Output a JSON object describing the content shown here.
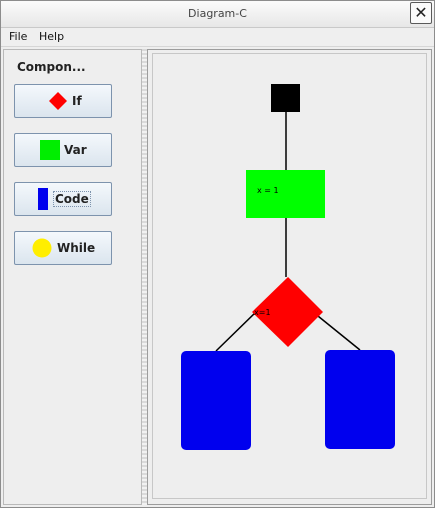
{
  "window": {
    "title": "Diagram-C",
    "close_glyph": "✕"
  },
  "menu": {
    "items": [
      "File",
      "Help"
    ]
  },
  "components": {
    "heading": "Compon...",
    "buttons": [
      {
        "label": "If",
        "icon": "red-diamond-icon",
        "color": "#ff0000"
      },
      {
        "label": "Var",
        "icon": "green-square-icon",
        "color": "#00ee00"
      },
      {
        "label": "Code",
        "icon": "blue-rect-icon",
        "color": "#0000ee"
      },
      {
        "label": "While",
        "icon": "yellow-circle-icon",
        "color": "#ffee00"
      }
    ]
  },
  "diagram": {
    "nodes": {
      "start": {
        "color": "#000000"
      },
      "var": {
        "label": "x = 1",
        "color": "#00ff00"
      },
      "if": {
        "label": "x=1",
        "color": "#ff0000"
      },
      "code_left": {
        "color": "#0000ee"
      },
      "code_right": {
        "color": "#0000ee"
      }
    }
  }
}
